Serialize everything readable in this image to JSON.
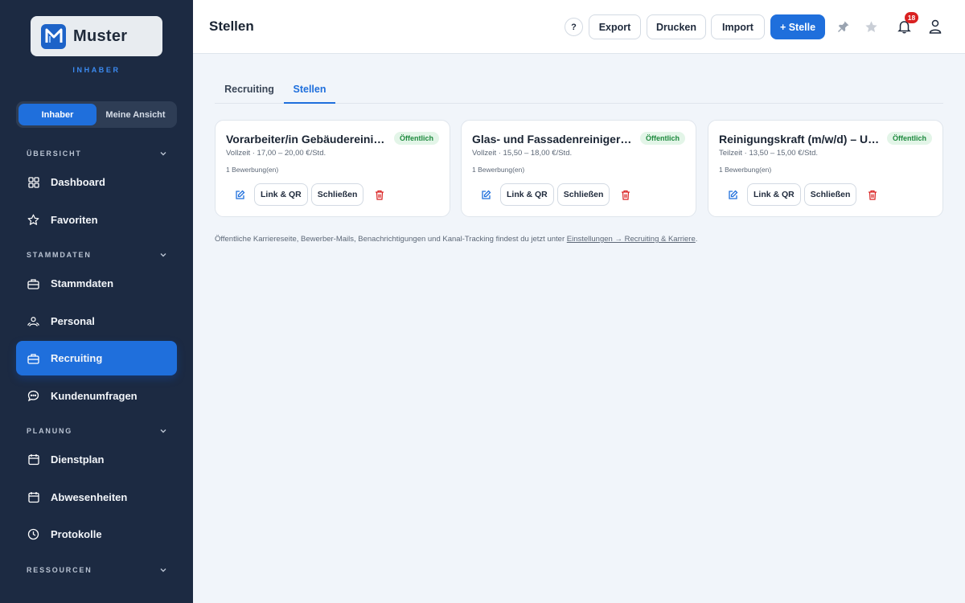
{
  "sidebar": {
    "logo_text": "Muster",
    "role_label": "INHABER",
    "view_toggle": {
      "active": "Inhaber",
      "other": "Meine Ansicht"
    },
    "sections": {
      "overview": "ÜBERSICHT",
      "master_data": "STAMMDATEN",
      "planning": "PLANUNG",
      "resources": "RESSOURCEN"
    },
    "items": {
      "dashboard": "Dashboard",
      "favorites": "Favoriten",
      "master_data": "Stammdaten",
      "staff": "Personal",
      "recruiting": "Recruiting",
      "surveys": "Kundenumfragen",
      "schedule": "Dienstplan",
      "absences": "Abwesenheiten",
      "logs": "Protokolle"
    }
  },
  "header": {
    "title": "Stellen",
    "help_label": "?",
    "export_label": "Export",
    "print_label": "Drucken",
    "import_label": "Import",
    "new_position_label": "+ Stelle",
    "notification_count": "18"
  },
  "tabs": [
    "Recruiting",
    "Stellen"
  ],
  "cards": [
    {
      "title": "Vorarbeiter/in Gebäudereinigung",
      "badge": "Öffentlich",
      "meta": "Vollzeit · 17,00 – 20,00 €/Std.",
      "applications": "1 Bewerbung(en)",
      "link_label": "Link & QR",
      "close_label": "Schließen"
    },
    {
      "title": "Glas- und Fassadenreiniger (m/w/d)",
      "badge": "Öffentlich",
      "meta": "Vollzeit · 15,50 – 18,00 €/Std.",
      "applications": "1 Bewerbung(en)",
      "link_label": "Link & QR",
      "close_label": "Schließen"
    },
    {
      "title": "Reinigungskraft (m/w/d) – Unterhaltsreinigung",
      "badge": "Öffentlich",
      "meta": "Teilzeit · 13,50 – 15,00 €/Std.",
      "applications": "1 Bewerbung(en)",
      "link_label": "Link & QR",
      "close_label": "Schließen"
    }
  ],
  "footnote": {
    "text": "Öffentliche Karriereseite, Bewerber-Mails, Benachrichtigungen und Kanal-Tracking findest du jetzt unter ",
    "link": "Einstellungen → Recruiting & Karriere",
    "end": "."
  },
  "colors": {
    "accent": "#1f6fdc",
    "sidebar_bg": "#1c2a42",
    "badge_green": "#1e8a3e",
    "danger": "#d92121"
  }
}
